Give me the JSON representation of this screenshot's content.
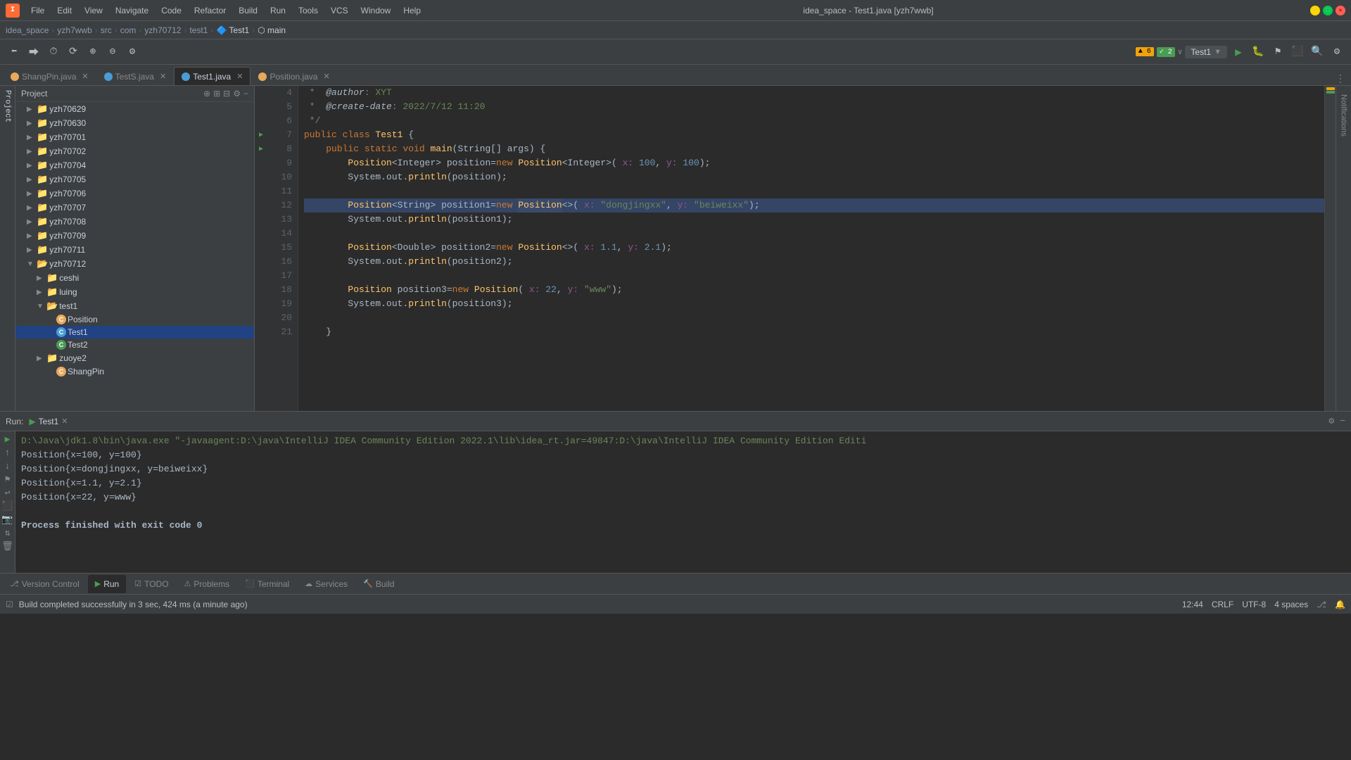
{
  "titlebar": {
    "logo": "I",
    "title": "idea_space - Test1.java [yzh7wwb]",
    "menus": [
      "File",
      "Edit",
      "View",
      "Navigate",
      "Code",
      "Refactor",
      "Build",
      "Run",
      "Tools",
      "VCS",
      "Window",
      "Help"
    ]
  },
  "breadcrumb": {
    "items": [
      "idea_space",
      "yzh7wwb",
      "src",
      "com",
      "yzh70712",
      "test1",
      "Test1",
      "main"
    ]
  },
  "toolbar": {
    "run_config": "Test1",
    "warn_count": "▲ 6",
    "ok_count": "✓ 2"
  },
  "tabs": [
    {
      "label": "ShangPin.java",
      "icon_color": "#e8a95b",
      "active": false
    },
    {
      "label": "TestS.java",
      "icon_color": "#4a9dd4",
      "active": false
    },
    {
      "label": "Test1.java",
      "icon_color": "#4a9dd4",
      "active": true
    },
    {
      "label": "Position.java",
      "icon_color": "#e8a95b",
      "active": false
    }
  ],
  "project": {
    "header": "Project",
    "tree": [
      {
        "label": "yzh70629",
        "indent": 1,
        "type": "folder",
        "expanded": false
      },
      {
        "label": "yzh70630",
        "indent": 1,
        "type": "folder",
        "expanded": false
      },
      {
        "label": "yzh70701",
        "indent": 1,
        "type": "folder",
        "expanded": false
      },
      {
        "label": "yzh70702",
        "indent": 1,
        "type": "folder",
        "expanded": false
      },
      {
        "label": "yzh70704",
        "indent": 1,
        "type": "folder",
        "expanded": false
      },
      {
        "label": "yzh70705",
        "indent": 1,
        "type": "folder",
        "expanded": false
      },
      {
        "label": "yzh70706",
        "indent": 1,
        "type": "folder",
        "expanded": false
      },
      {
        "label": "yzh70707",
        "indent": 1,
        "type": "folder",
        "expanded": false
      },
      {
        "label": "yzh70708",
        "indent": 1,
        "type": "folder",
        "expanded": false
      },
      {
        "label": "yzh70709",
        "indent": 1,
        "type": "folder",
        "expanded": false
      },
      {
        "label": "yzh70711",
        "indent": 1,
        "type": "folder",
        "expanded": false
      },
      {
        "label": "yzh70712",
        "indent": 1,
        "type": "folder",
        "expanded": true
      },
      {
        "label": "ceshi",
        "indent": 2,
        "type": "folder",
        "expanded": false
      },
      {
        "label": "luing",
        "indent": 2,
        "type": "folder",
        "expanded": false
      },
      {
        "label": "test1",
        "indent": 2,
        "type": "folder",
        "expanded": true
      },
      {
        "label": "Position",
        "indent": 3,
        "type": "file",
        "file_type": "orange"
      },
      {
        "label": "Test1",
        "indent": 3,
        "type": "file",
        "file_type": "blue",
        "selected": true
      },
      {
        "label": "Test2",
        "indent": 3,
        "type": "file",
        "file_type": "green"
      },
      {
        "label": "zuoye2",
        "indent": 2,
        "type": "folder",
        "expanded": false
      },
      {
        "label": "ShangPin",
        "indent": 3,
        "type": "file",
        "file_type": "orange"
      }
    ]
  },
  "code": {
    "lines": [
      {
        "num": 4,
        "content": " *  @author: XYT",
        "type": "comment"
      },
      {
        "num": 5,
        "content": " *  @create-date: 2022/7/12 11:20",
        "type": "comment"
      },
      {
        "num": 6,
        "content": " */",
        "type": "comment"
      },
      {
        "num": 7,
        "content": "public class Test1 {",
        "type": "code",
        "has_run": true
      },
      {
        "num": 8,
        "content": "    public static void main(String[] args) {",
        "type": "code",
        "has_run": true
      },
      {
        "num": 9,
        "content": "        Position<Integer> position=new Position<Integer>( x: 100, y: 100);",
        "type": "code"
      },
      {
        "num": 10,
        "content": "        System.out.println(position);",
        "type": "code"
      },
      {
        "num": 11,
        "content": "",
        "type": "blank"
      },
      {
        "num": 12,
        "content": "        Position<String> position1=new Position<>( x: \"dongjingxx\", y: \"beiweixx\");",
        "type": "code",
        "highlighted": true
      },
      {
        "num": 13,
        "content": "        System.out.println(position1);",
        "type": "code"
      },
      {
        "num": 14,
        "content": "",
        "type": "blank"
      },
      {
        "num": 15,
        "content": "        Position<Double> position2=new Position<>( x: 1.1, y: 2.1);",
        "type": "code"
      },
      {
        "num": 16,
        "content": "        System.out.println(position2);",
        "type": "code"
      },
      {
        "num": 17,
        "content": "",
        "type": "blank"
      },
      {
        "num": 18,
        "content": "        Position position3=new Position( x: 22, y: \"www\");",
        "type": "code"
      },
      {
        "num": 19,
        "content": "        System.out.println(position3);",
        "type": "code"
      },
      {
        "num": 20,
        "content": "",
        "type": "blank"
      },
      {
        "num": 21,
        "content": "    }",
        "type": "code"
      }
    ]
  },
  "run": {
    "label": "Run:",
    "tab": "Test1",
    "command": "D:\\Java\\jdk1.8\\bin\\java.exe \"-javaagent:D:\\java\\IntelliJ IDEA Community Edition 2022.1\\lib\\idea_rt.jar=49847:D:\\java\\IntelliJ IDEA Community Edition",
    "output": [
      "Position{x=100, y=100}",
      "Position{x=dongjingxx, y=beiweixx}",
      "Position{x=1.1, y=2.1}",
      "Position{x=22, y=www}",
      "",
      "Process finished with exit code 0"
    ]
  },
  "bottom_tabs": [
    {
      "label": "Version Control",
      "icon": "⎇",
      "active": false
    },
    {
      "label": "Run",
      "icon": "▶",
      "active": true
    },
    {
      "label": "TODO",
      "icon": "☑",
      "active": false
    },
    {
      "label": "Problems",
      "icon": "⚠",
      "active": false
    },
    {
      "label": "Terminal",
      "icon": "⬛",
      "active": false
    },
    {
      "label": "Services",
      "icon": "☁",
      "active": false
    },
    {
      "label": "Build",
      "icon": "🔨",
      "active": false
    }
  ],
  "status": {
    "message": "Build completed successfully in 3 sec, 424 ms (a minute ago)",
    "time": "12:44",
    "encoding": "UTF-8",
    "line_sep": "CRLF",
    "indent": "4 spaces"
  },
  "notifications_panel": {
    "label": "Notifications"
  }
}
